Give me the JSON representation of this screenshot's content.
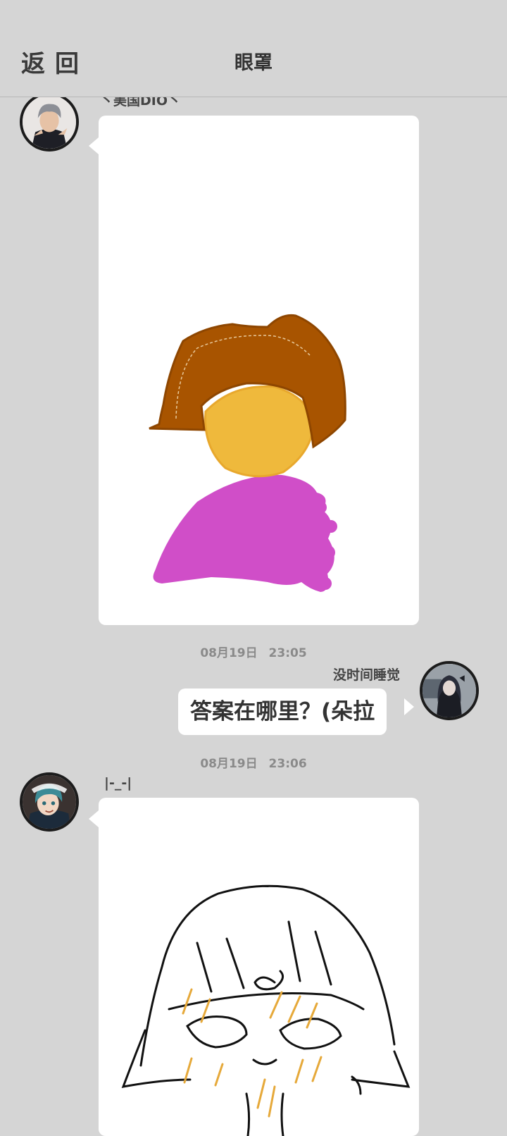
{
  "header": {
    "back_label": "返回",
    "title": "眼罩"
  },
  "messages": [
    {
      "sender": "丶美国DIO丶",
      "type": "image",
      "side": "left",
      "content": "drawing-hat-figure",
      "colors": {
        "hat": "#a85400",
        "face": "#efb93c",
        "body": "#d04ec8"
      }
    },
    {
      "timestamp": "08月19日 23:05",
      "sender": "没时间睡觉",
      "type": "text",
      "side": "right",
      "text": "答案在哪里？(朵拉"
    },
    {
      "timestamp": "08月19日 23:06",
      "sender": "|-_-|",
      "type": "image",
      "side": "left",
      "content": "drawing-girl-sketch",
      "colors": {
        "line": "#111111",
        "hatch": "#e6a93a"
      }
    }
  ],
  "theme": {
    "background": "#d5d5d5",
    "bubble": "#ffffff",
    "timestamp_color": "#8a8a8a"
  }
}
